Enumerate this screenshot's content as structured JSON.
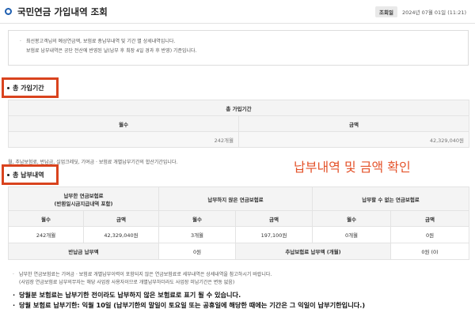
{
  "header": {
    "title": "국민연금 가입내역 조회",
    "view_date_label": "조회일",
    "view_date": "2024년 07월 01일 (11:21)"
  },
  "notice": {
    "line1": "최선봉고객님의 예상연금액, 보험료 총납부내역 및 기간 별 상세내역입니다.",
    "line2": "보험료 납부내역은 공단 전산에 반영된 날(납부 후 최장 4일 경과 후 반영) 기준입니다."
  },
  "period_section": {
    "badge": "총 가입기간",
    "table_title": "총 가입기간",
    "col_months": "월수",
    "col_amount": "금액",
    "months": "242개월",
    "amount": "42,329,040원"
  },
  "hidden_note": "월, 추납보험료, 반납금, 실업크레딧, 기여금 · 보험료 개별납부기간의 합산기간입니다.",
  "annotation": "납부내역 및 금액 확인",
  "payment_section": {
    "badge": "총 납부내역",
    "group1_line1": "납부한 연금보험료",
    "group1_line2": "(반환일시금지급내역 포함)",
    "group2": "납부하지 않은 연금보험료",
    "group3": "납부할 수 없는 연금보험료",
    "col_months": "월수",
    "col_amount": "금액",
    "paid_months": "242개월",
    "paid_amount": "42,329,040원",
    "unpaid_months": "3개월",
    "unpaid_amount": "197,100원",
    "cannot_months": "0개월",
    "cannot_amount": "0원",
    "return_label": "반납금 납부액",
    "return_value": "0원",
    "extra_label": "추납보험료 납부액 (개월)",
    "extra_value": "0원 (0)"
  },
  "footer": {
    "line1": "납부한 연금보험료는 기여금 · 보험료 개별납부이력이 포함되지 않은 연금보험료로 세부내역은 상세내역을 참고하시기 바랍니다.",
    "line2": "(사업장 연금보험료 납부의무자는 해당 사업장 사용자이므로 개별납부하더라도 사업장 미납기간은 변동 없음)",
    "bold1": "당월분 보험료는 납부기한 전이라도 납부하지 않은 보험료로 표기 될 수 있습니다.",
    "bold2": "당월 보험료 납부기한: 익월 10일 (납부기한의 말일이 토요일 또는 공휴일에 해당한 때에는 기간은 그 익일이 납부기한입니다.)"
  },
  "colors": {
    "accent": "#1f5fb0",
    "badge_border": "#d9431e",
    "annotation": "#e4532b"
  }
}
